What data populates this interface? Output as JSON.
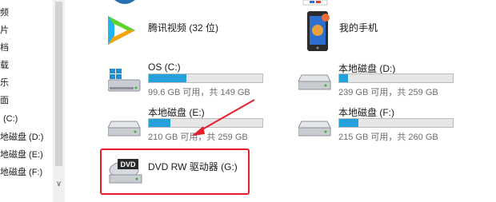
{
  "nav_pane": {
    "items": [
      "频",
      "片",
      "档",
      "载",
      "乐",
      "面",
      "(C:)",
      "地磁盘 (D:)",
      "地磁盘 (E:)",
      "地磁盘 (F:)"
    ]
  },
  "devices": [
    {
      "name": "腾讯视频 (32 位)",
      "icon": "tencent-video-icon"
    },
    {
      "name": "我的手机",
      "icon": "phone-icon"
    }
  ],
  "drives": [
    {
      "name": "OS (C:)",
      "free": "99.6 GB 可用，共 149 GB",
      "used_fraction": 0.33,
      "icon": "windows-drive-icon"
    },
    {
      "name": "本地磁盘 (D:)",
      "free": "239 GB 可用，共 259 GB",
      "used_fraction": 0.08,
      "icon": "drive-icon"
    },
    {
      "name": "本地磁盘 (E:)",
      "free": "210 GB 可用，共 259 GB",
      "used_fraction": 0.19,
      "icon": "drive-icon"
    },
    {
      "name": "本地磁盘 (F:)",
      "free": "215 GB 可用，共 260 GB",
      "used_fraction": 0.17,
      "icon": "drive-icon"
    },
    {
      "name": "DVD RW 驱动器 (G:)",
      "icon": "dvd-drive-icon",
      "badge": "DVD"
    }
  ],
  "annotation": {
    "highlight_color": "#e5202a"
  },
  "colors": {
    "bar_fill": "#26a0da",
    "bar_track": "#e6e6e6"
  }
}
